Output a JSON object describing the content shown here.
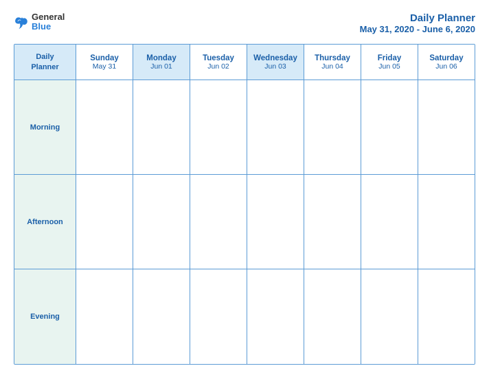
{
  "header": {
    "logo": {
      "general": "General",
      "blue": "Blue"
    },
    "title": "Daily Planner",
    "date_range": "May 31, 2020 - June 6, 2020"
  },
  "planner": {
    "column_label": {
      "line1": "Daily",
      "line2": "Planner"
    },
    "days": [
      {
        "name": "Sunday",
        "date": "May 31"
      },
      {
        "name": "Monday",
        "date": "Jun 01"
      },
      {
        "name": "Tuesday",
        "date": "Jun 02"
      },
      {
        "name": "Wednesday",
        "date": "Jun 03"
      },
      {
        "name": "Thursday",
        "date": "Jun 04"
      },
      {
        "name": "Friday",
        "date": "Jun 05"
      },
      {
        "name": "Saturday",
        "date": "Jun 06"
      }
    ],
    "rows": [
      "Morning",
      "Afternoon",
      "Evening"
    ]
  }
}
